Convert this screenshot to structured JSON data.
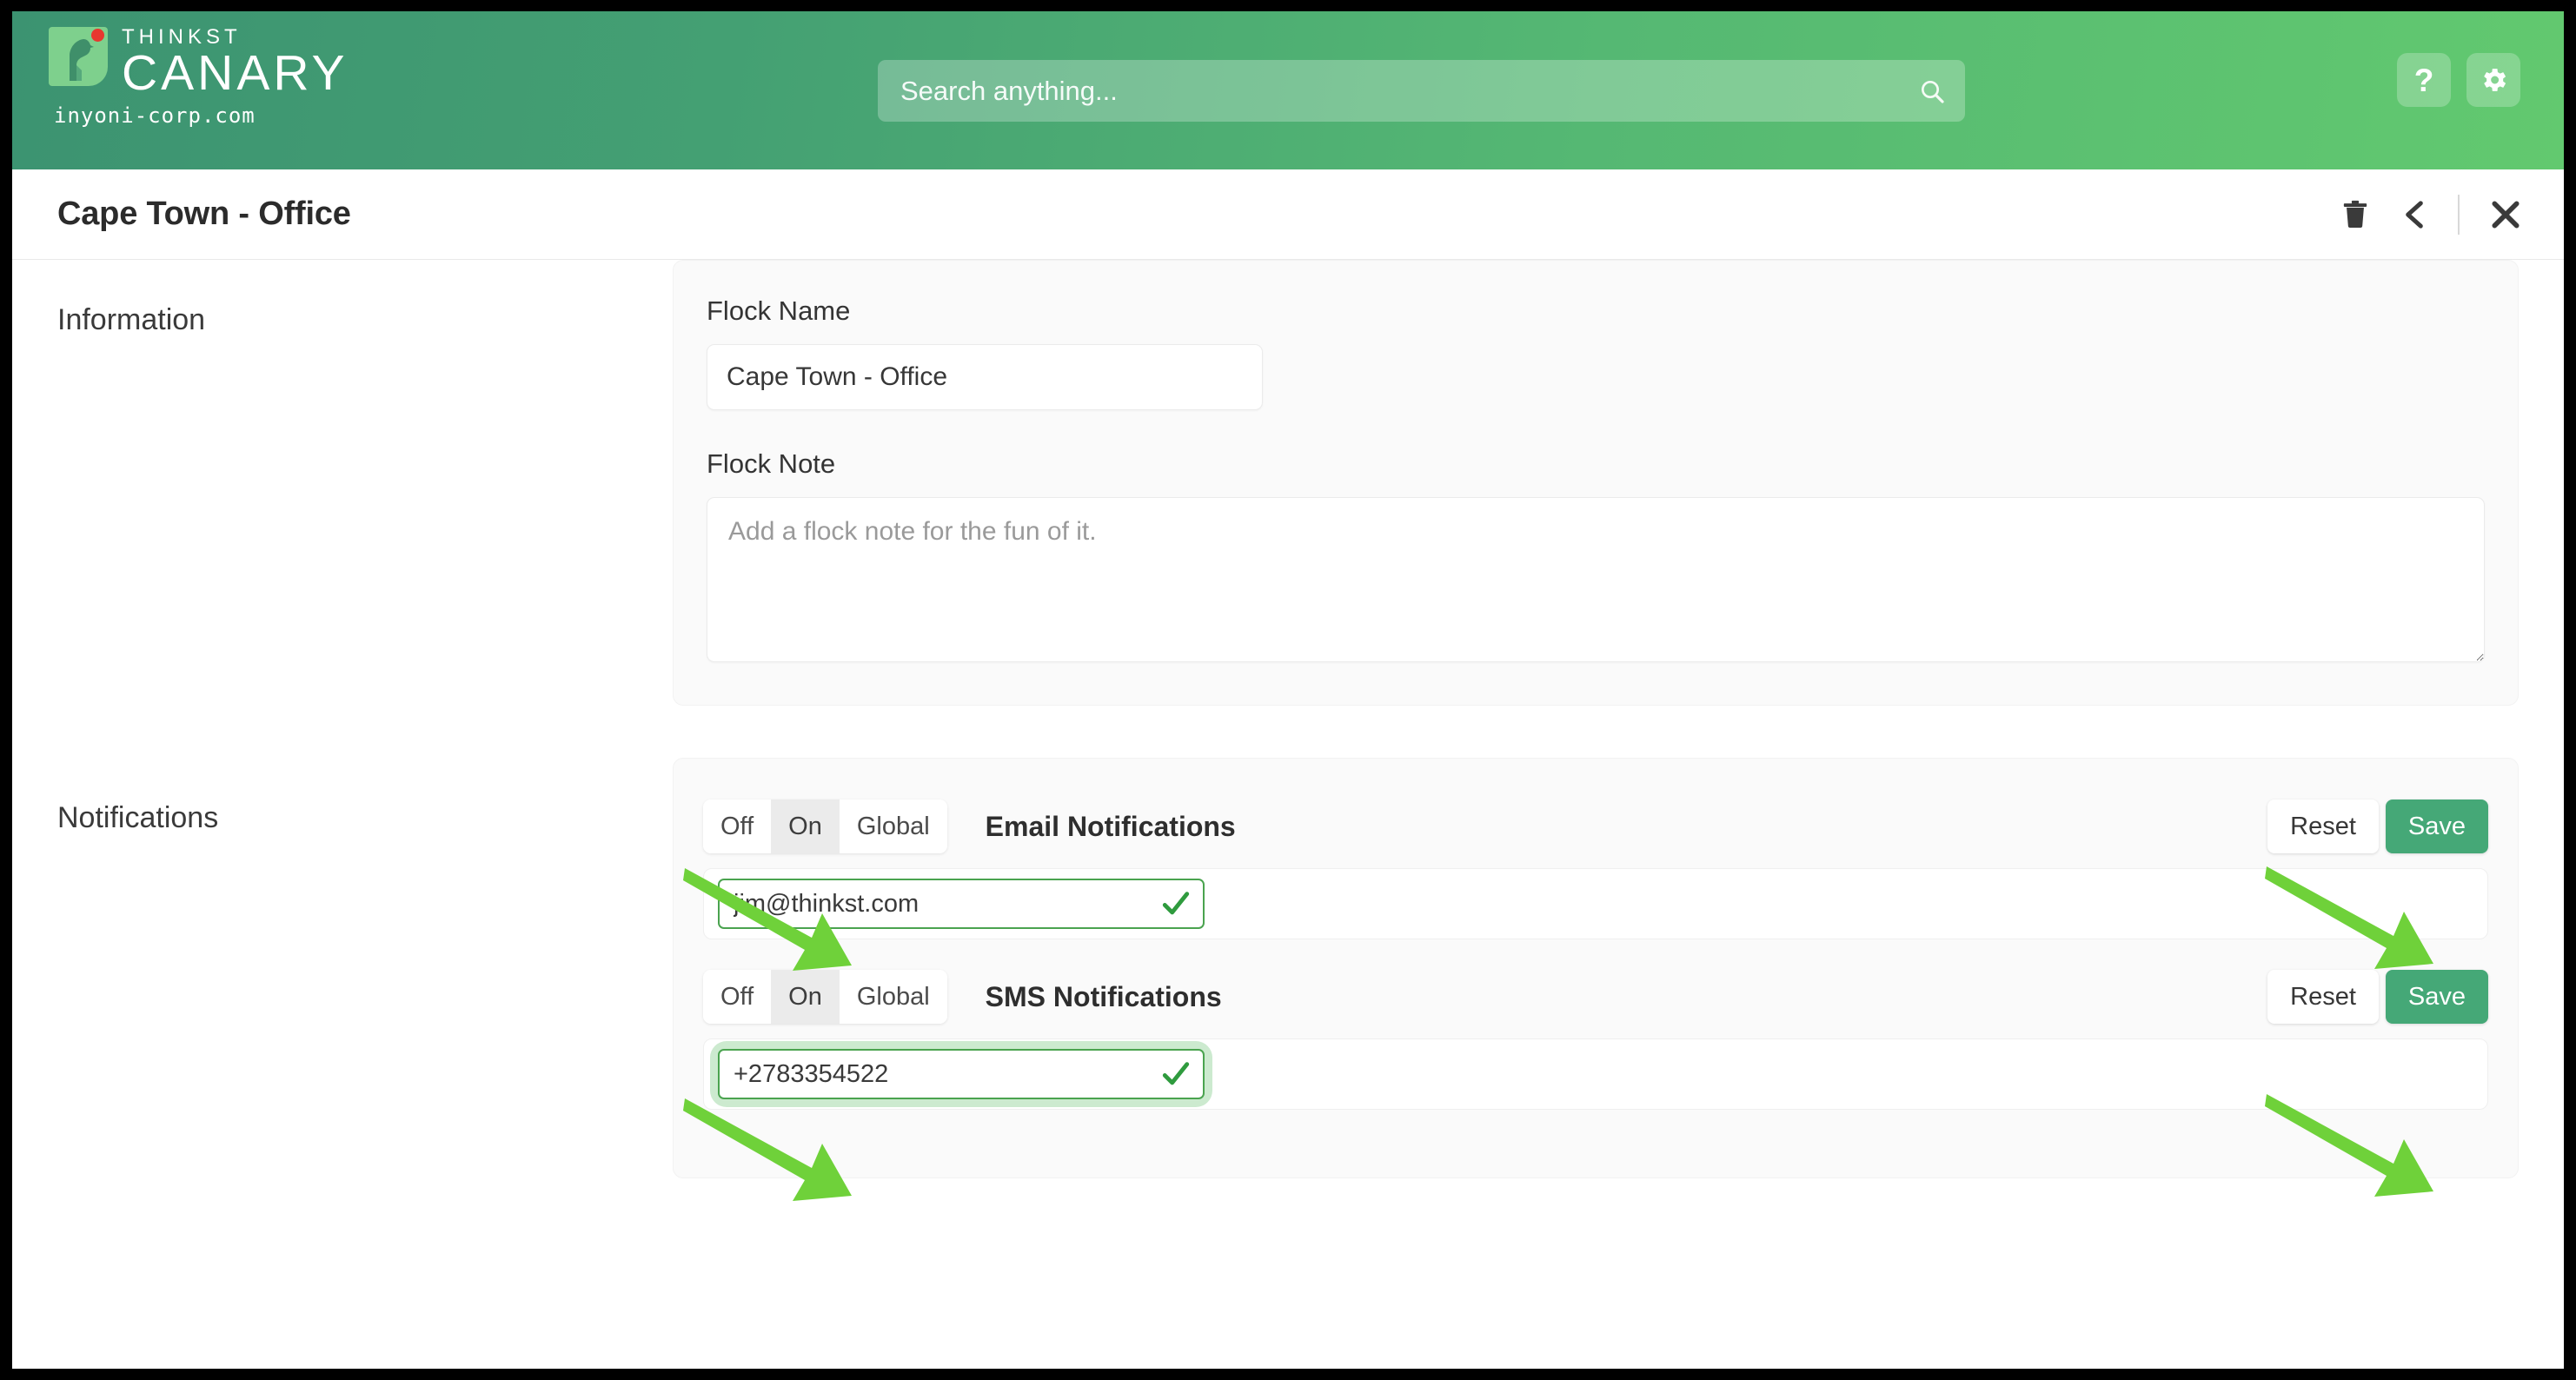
{
  "brand": {
    "thinkst": "THINKST",
    "canary": "CANARY",
    "domain": "inyoni-corp.com",
    "logo_icon": "canary-bird-logo"
  },
  "search": {
    "placeholder": "Search anything...",
    "value": "",
    "icon": "search-icon"
  },
  "topbar": {
    "help_label": "?",
    "help_icon": "question-mark-icon",
    "settings_icon": "gear-icon"
  },
  "titlebar": {
    "title": "Cape Town - Office",
    "delete_icon": "trash-icon",
    "back_icon": "chevron-left-icon",
    "close_icon": "close-x-icon"
  },
  "information": {
    "section_label": "Information",
    "flock_name_label": "Flock Name",
    "flock_name_value": "Cape Town - Office",
    "flock_note_label": "Flock Note",
    "flock_note_value": "",
    "flock_note_placeholder": "Add a flock note for the fun of it."
  },
  "notifications": {
    "section_label": "Notifications",
    "segment_options": [
      "Off",
      "On",
      "Global"
    ],
    "reset_label": "Reset",
    "save_label": "Save",
    "rows": [
      {
        "name": "Email Notifications",
        "selected": "On",
        "value": "jim@thinkst.com",
        "valid": true,
        "focused": false,
        "check_icon": "checkmark-icon"
      },
      {
        "name": "SMS Notifications",
        "selected": "On",
        "value": "+2783354522",
        "valid": true,
        "focused": true,
        "check_icon": "checkmark-icon"
      }
    ]
  },
  "annotations": {
    "arrow_color": "#6fd13a",
    "arrows": [
      {
        "name": "arrow-to-email-on-toggle"
      },
      {
        "name": "arrow-to-email-save-button"
      },
      {
        "name": "arrow-to-sms-on-toggle"
      },
      {
        "name": "arrow-to-sms-save-button"
      }
    ]
  },
  "colors": {
    "header_gradient_start": "#3c9371",
    "header_gradient_end": "#62c96f",
    "save_green": "#45a877",
    "valid_border_green": "#4aa34f",
    "logo_green": "#7ed08d",
    "logo_dot_red": "#e8382f",
    "annotation_green": "#6fd13a"
  }
}
